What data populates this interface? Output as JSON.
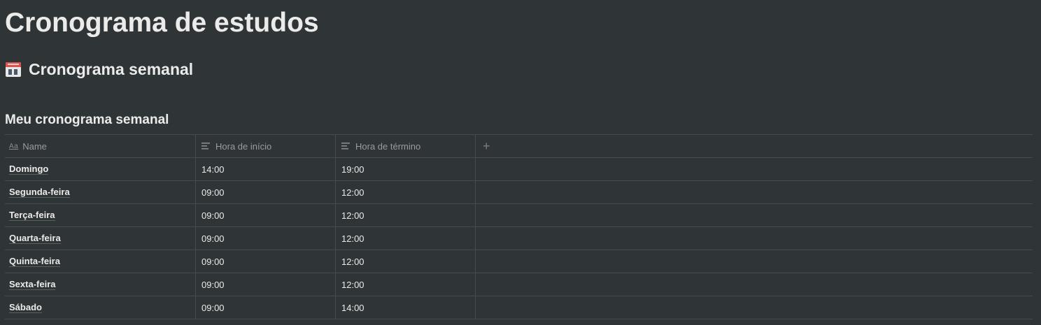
{
  "page": {
    "title": "Cronograma de estudos"
  },
  "section": {
    "icon": "calendar-icon",
    "title": "Cronograma semanal"
  },
  "database": {
    "title": "Meu cronograma semanal",
    "columns": [
      {
        "label": "Name",
        "icon": "title-aa-icon"
      },
      {
        "label": "Hora de início",
        "icon": "text-lines-icon"
      },
      {
        "label": "Hora de término",
        "icon": "text-lines-icon"
      }
    ],
    "add_column_symbol": "+",
    "rows": [
      {
        "name": "Domingo",
        "start": "14:00",
        "end": "19:00"
      },
      {
        "name": "Segunda-feira",
        "start": "09:00",
        "end": "12:00"
      },
      {
        "name": "Terça-feira",
        "start": "09:00",
        "end": "12:00"
      },
      {
        "name": "Quarta-feira",
        "start": "09:00",
        "end": "12:00"
      },
      {
        "name": "Quinta-feira",
        "start": "09:00",
        "end": "12:00"
      },
      {
        "name": "Sexta-feira",
        "start": "09:00",
        "end": "12:00"
      },
      {
        "name": "Sábado",
        "start": "09:00",
        "end": "14:00"
      }
    ]
  },
  "colors": {
    "background": "#2f3437",
    "text": "#ebebea",
    "muted_text": "#9b9b9b",
    "border": "#454b4e",
    "calendar_red": "#d9534f"
  }
}
